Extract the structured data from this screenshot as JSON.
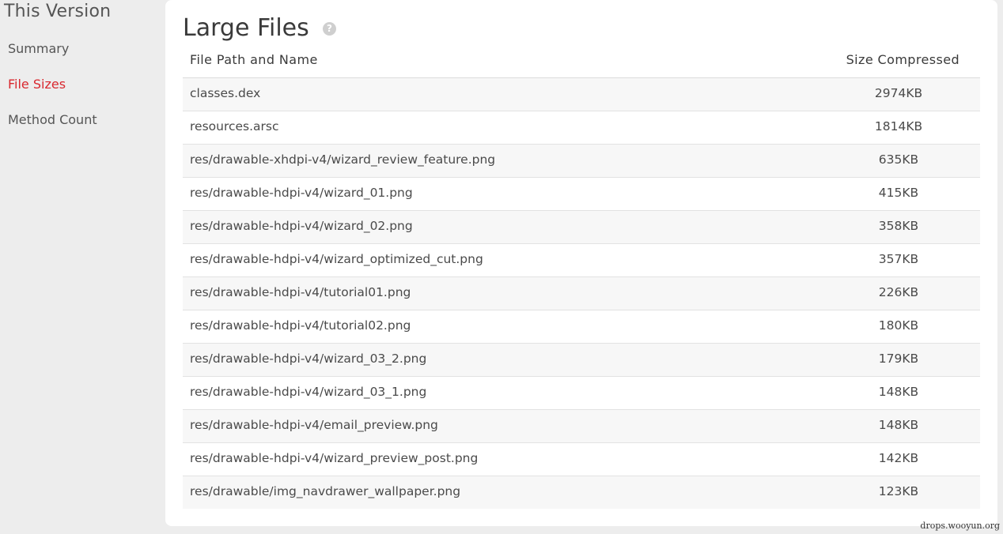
{
  "sidebar": {
    "title": "This Version",
    "items": [
      {
        "label": "Summary",
        "active": false
      },
      {
        "label": "File Sizes",
        "active": true
      },
      {
        "label": "Method Count",
        "active": false
      }
    ]
  },
  "main": {
    "title": "Large Files",
    "help_icon": "question-circle-icon",
    "table": {
      "headers": {
        "path": "File Path and Name",
        "size": "Size Compressed"
      },
      "rows": [
        {
          "path": "classes.dex",
          "size": "2974KB"
        },
        {
          "path": "resources.arsc",
          "size": "1814KB"
        },
        {
          "path": "res/drawable-xhdpi-v4/wizard_review_feature.png",
          "size": "635KB"
        },
        {
          "path": "res/drawable-hdpi-v4/wizard_01.png",
          "size": "415KB"
        },
        {
          "path": "res/drawable-hdpi-v4/wizard_02.png",
          "size": "358KB"
        },
        {
          "path": "res/drawable-hdpi-v4/wizard_optimized_cut.png",
          "size": "357KB"
        },
        {
          "path": "res/drawable-hdpi-v4/tutorial01.png",
          "size": "226KB"
        },
        {
          "path": "res/drawable-hdpi-v4/tutorial02.png",
          "size": "180KB"
        },
        {
          "path": "res/drawable-hdpi-v4/wizard_03_2.png",
          "size": "179KB"
        },
        {
          "path": "res/drawable-hdpi-v4/wizard_03_1.png",
          "size": "148KB"
        },
        {
          "path": "res/drawable-hdpi-v4/email_preview.png",
          "size": "148KB"
        },
        {
          "path": "res/drawable-hdpi-v4/wizard_preview_post.png",
          "size": "142KB"
        },
        {
          "path": "res/drawable/img_navdrawer_wallpaper.png",
          "size": "123KB"
        }
      ]
    }
  },
  "watermark": "drops.wooyun.org",
  "colors": {
    "accent": "#d9282f",
    "background": "#ededed",
    "card": "#ffffff",
    "row_alt": "#f7f7f7"
  }
}
